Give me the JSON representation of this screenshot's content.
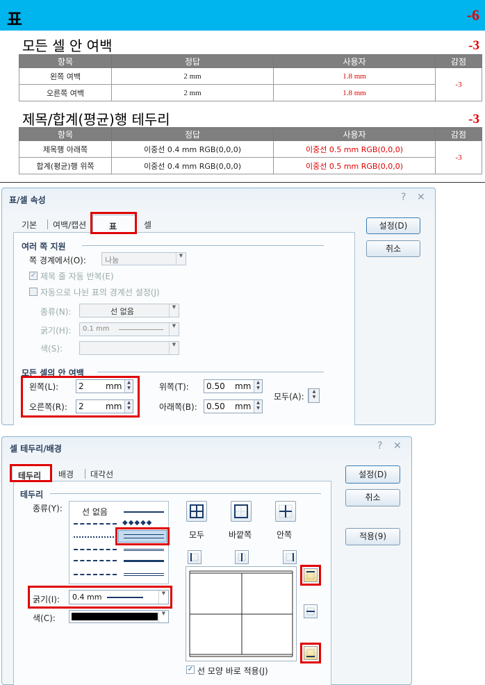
{
  "header": {
    "title": "표",
    "score": "-6"
  },
  "margin_section": {
    "title": "모든 셀 안 여백",
    "score": "-3",
    "columns": [
      "항목",
      "정답",
      "사용자",
      "감점"
    ],
    "rows": [
      {
        "item": "왼쪽 여백",
        "answer": "2 mm",
        "user": "1.8 mm"
      },
      {
        "item": "오른쪽 여백",
        "answer": "2 mm",
        "user": "1.8 mm"
      }
    ],
    "deduction": "-3"
  },
  "border_section": {
    "title": "제목/합계(평균)행 테두리",
    "score": "-3",
    "columns": [
      "항목",
      "정답",
      "사용자",
      "감점"
    ],
    "rows": [
      {
        "item": "제목행 아래쪽",
        "answer_type": "이중선",
        "answer_spec": "0.4 mm RGB(0,0,0)",
        "user_type": "이중선",
        "user_spec": "0.5 mm RGB(0,0,0)"
      },
      {
        "item": "합계(평균)행 위쪽",
        "answer_type": "이중선",
        "answer_spec": "0.4 mm RGB(0,0,0)",
        "user_type": "이중선",
        "user_spec": "0.5 mm RGB(0,0,0)"
      }
    ],
    "deduction": "-3"
  },
  "table_dialog": {
    "title": "표/셀 속성",
    "help": "?",
    "close": "✕",
    "tabs": [
      "기본",
      "여백/캡션",
      "표",
      "셀"
    ],
    "buttons": {
      "ok": "설정(D)",
      "cancel": "취소"
    },
    "multi_page": {
      "group": "여러 쪽 지원",
      "split_label": "쪽 경계에서(O):",
      "split_value": "나눔",
      "repeat_header": "제목 줄 자동 반복(E)",
      "auto_border": "자동으로 나뉜 표의 경계선 설정(J)",
      "type_label": "종류(N):",
      "type_value": "선 없음",
      "thickness_label": "굵기(H):",
      "thickness_value": "0.1 mm",
      "color_label": "색(S):"
    },
    "padding": {
      "group": "모든 셀의 안 여백",
      "left_label": "왼쪽(L):",
      "left_value": "2",
      "left_unit": "mm",
      "right_label": "오른쪽(R):",
      "right_value": "2",
      "right_unit": "mm",
      "top_label": "위쪽(T):",
      "top_value": "0.50",
      "top_unit": "mm",
      "bottom_label": "아래쪽(B):",
      "bottom_value": "0.50",
      "bottom_unit": "mm",
      "all_label": "모두(A):"
    }
  },
  "border_dialog": {
    "title": "셀 테두리/배경",
    "help": "?",
    "close": "✕",
    "tabs": [
      "테두리",
      "배경",
      "대각선"
    ],
    "buttons": {
      "ok": "설정(D)",
      "cancel": "취소",
      "apply": "적용(9)"
    },
    "group": "테두리",
    "type_label": "종류(Y):",
    "no_line": "선 없음",
    "thickness_label": "굵기(I):",
    "thickness_value": "0.4 mm",
    "color_label": "색(C):",
    "presets": [
      "모두",
      "바깥쪽",
      "안쪽"
    ],
    "apply_check": "선 모양 바로 적용(J)"
  }
}
